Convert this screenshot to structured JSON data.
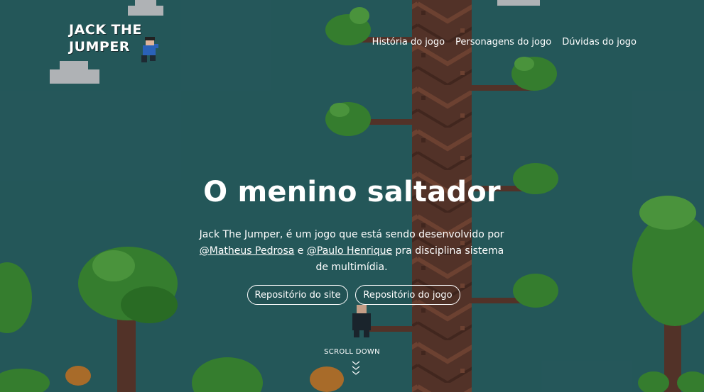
{
  "logo": {
    "line1": "JACK THE",
    "line2": "JUMPER"
  },
  "nav": {
    "items": [
      {
        "label": "História do jogo"
      },
      {
        "label": "Personagens do jogo"
      },
      {
        "label": "Dúvidas do jogo"
      }
    ]
  },
  "hero": {
    "title": "O menino saltador",
    "text_part1": "Jack The Jumper, é um jogo que está sendo desenvolvido por ",
    "author1": "@Matheus Pedrosa",
    "text_part2": " e ",
    "author2": "@Paulo Henrique",
    "text_part3": " pra disciplina sistema de multimídia.",
    "buttons": {
      "site": "Repositório do site",
      "game": "Repositório do jogo"
    }
  },
  "scroll": {
    "label": "SCROLL DOWN"
  },
  "colors": {
    "background": "#2a6366",
    "trunk": "#5e3a2e",
    "leaves": "#3d8f35",
    "text": "#ffffff"
  },
  "icons": {
    "player": "player-sprite-icon",
    "scroll": "chevron-down-icon"
  }
}
